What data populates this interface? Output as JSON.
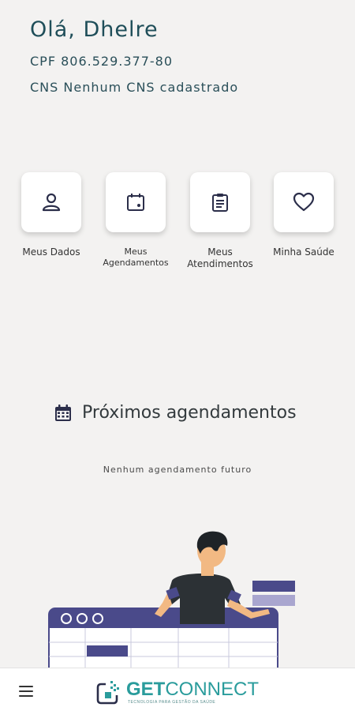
{
  "user": {
    "greeting": "Olá, Dhelre",
    "cpf": "CPF 806.529.377-80",
    "cns": "CNS Nenhum CNS cadastrado"
  },
  "menu": [
    {
      "label": "Meus Dados",
      "icon": "user-icon"
    },
    {
      "label": "Meus Agendamentos",
      "icon": "calendar-icon"
    },
    {
      "label": "Meus Atendimentos",
      "icon": "clipboard-icon"
    },
    {
      "label": "Minha Saúde",
      "icon": "heart-icon"
    }
  ],
  "appointments": {
    "title": "Próximos agendamentos",
    "icon": "calendar-icon",
    "empty_message": "Nenhum agendamento futuro"
  },
  "bottom_bar": {
    "menu_icon": "hamburger-icon",
    "logo_prefix": "GET",
    "logo_suffix": "CONNECT",
    "logo_tagline": "TECNOLOGIA PARA GESTÃO DA SAÚDE"
  },
  "colors": {
    "background": "#f3f2f1",
    "text_primary": "#1f4e59",
    "accent_purple": "#4a4a8a",
    "logo_teal": "#2a9c9c"
  }
}
